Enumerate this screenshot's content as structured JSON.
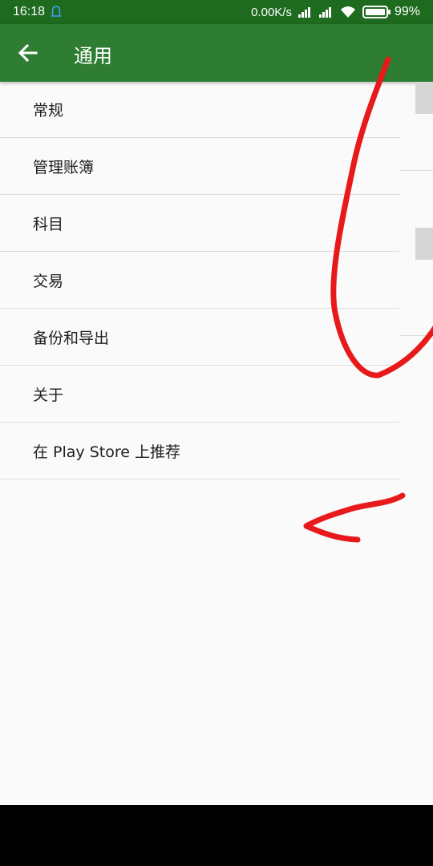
{
  "status_bar": {
    "time": "16:18",
    "network_speed": "0.00K/s",
    "battery_percent": "99%",
    "icons": [
      "notification-icon",
      "signal-icon",
      "signal-icon",
      "wifi-icon",
      "battery-icon"
    ]
  },
  "app_bar": {
    "title": "通用",
    "back_icon": "back-arrow-icon",
    "color": "#2e7d32"
  },
  "menu": {
    "items": [
      {
        "label": "常规"
      },
      {
        "label": "管理账簿"
      },
      {
        "label": "科目"
      },
      {
        "label": "交易"
      },
      {
        "label": "备份和导出"
      },
      {
        "label": "关于"
      },
      {
        "label": "在 Play Store 上推荐"
      }
    ]
  },
  "colors": {
    "status_bar": "#1e6a1e",
    "app_bar": "#2e7d32",
    "background": "#fafafa",
    "divider": "#dcdcdc",
    "annotation": "#e8191a"
  }
}
